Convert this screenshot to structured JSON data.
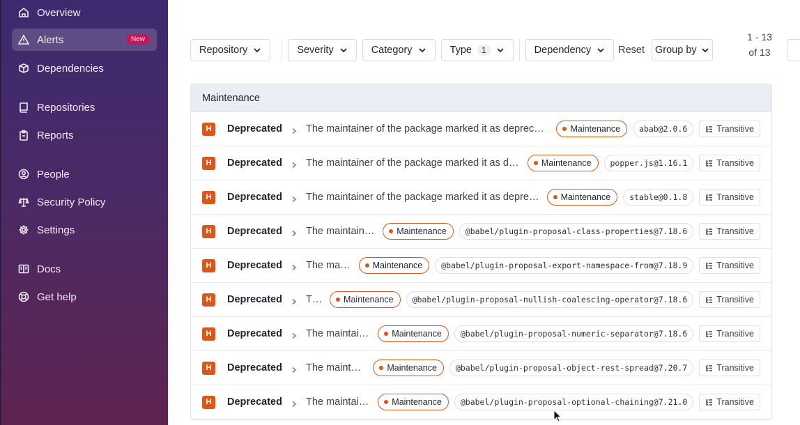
{
  "sidebar": {
    "items": [
      {
        "label": "Overview",
        "icon": "home-icon"
      },
      {
        "label": "Alerts",
        "icon": "warning-triangle-icon",
        "badge": "New",
        "active": true
      },
      {
        "label": "Dependencies",
        "icon": "package-box-icon"
      },
      {
        "label": "Repositories",
        "icon": "book-icon"
      },
      {
        "label": "Reports",
        "icon": "clipboard-icon"
      },
      {
        "label": "People",
        "icon": "user-circle-icon"
      },
      {
        "label": "Security Policy",
        "icon": "scale-icon"
      },
      {
        "label": "Settings",
        "icon": "gear-icon"
      },
      {
        "label": "Docs",
        "icon": "docs-icon"
      },
      {
        "label": "Get help",
        "icon": "lifebuoy-icon"
      }
    ]
  },
  "filters": {
    "repository": "Repository",
    "severity": "Severity",
    "category": "Category",
    "type": "Type",
    "type_count": "1",
    "dependency": "Dependency",
    "reset": "Reset",
    "group_by": "Group by"
  },
  "pager": {
    "range": "1 - 13 of 13"
  },
  "group": {
    "name": "Maintenance"
  },
  "rows": [
    {
      "severity": "H",
      "title": "Deprecated",
      "description": "The maintainer of the package marked it as deprecated",
      "category": "Maintenance",
      "package": "abab@2.0.6",
      "type": "Transitive"
    },
    {
      "severity": "H",
      "title": "Deprecated",
      "description": "The maintainer of the package marked it as deprecated",
      "category": "Maintenance",
      "package": "popper.js@1.16.1",
      "type": "Transitive"
    },
    {
      "severity": "H",
      "title": "Deprecated",
      "description": "The maintainer of the package marked it as deprecated",
      "category": "Maintenance",
      "package": "stable@0.1.8",
      "type": "Transitive"
    },
    {
      "severity": "H",
      "title": "Deprecated",
      "description": "The maintainer of the package marked it as deprecated",
      "category": "Maintenance",
      "package": "@babel/plugin-proposal-class-properties@7.18.6",
      "type": "Transitive"
    },
    {
      "severity": "H",
      "title": "Deprecated",
      "description": "The maintainer of the package marked it as deprecated",
      "category": "Maintenance",
      "package": "@babel/plugin-proposal-export-namespace-from@7.18.9",
      "type": "Transitive"
    },
    {
      "severity": "H",
      "title": "Deprecated",
      "description": "The maintainer of the package marked it as deprecated",
      "category": "Maintenance",
      "package": "@babel/plugin-proposal-nullish-coalescing-operator@7.18.6",
      "type": "Transitive"
    },
    {
      "severity": "H",
      "title": "Deprecated",
      "description": "The maintainer of the package marked it as deprecated",
      "category": "Maintenance",
      "package": "@babel/plugin-proposal-numeric-separator@7.18.6",
      "type": "Transitive"
    },
    {
      "severity": "H",
      "title": "Deprecated",
      "description": "The maintainer of the package marked it as deprecated",
      "category": "Maintenance",
      "package": "@babel/plugin-proposal-object-rest-spread@7.20.7",
      "type": "Transitive"
    },
    {
      "severity": "H",
      "title": "Deprecated",
      "description": "The maintainer of the package marked it as deprecated",
      "category": "Maintenance",
      "package": "@babel/plugin-proposal-optional-chaining@7.21.0",
      "type": "Transitive"
    }
  ],
  "colors": {
    "severity_high": "#d5581f",
    "sidebar_top": "#3d2a6e",
    "sidebar_bottom": "#5e2450",
    "badge": "#c2185b"
  }
}
